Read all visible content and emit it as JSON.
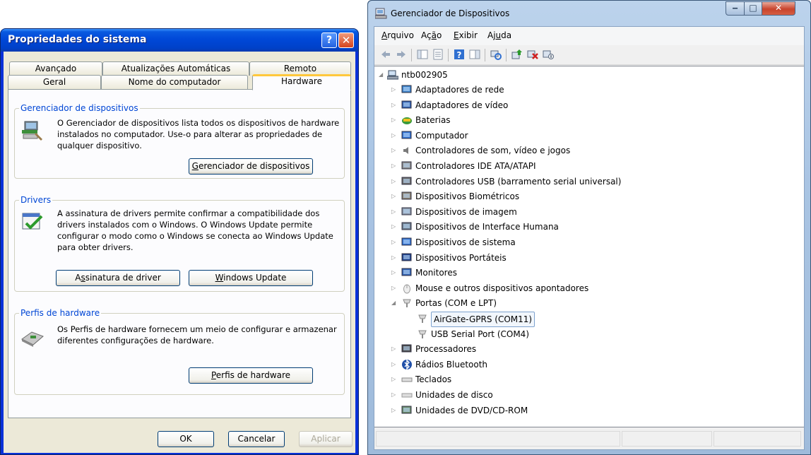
{
  "xp": {
    "title": "Propriedades do sistema",
    "help_glyph": "?",
    "close_glyph": "✕",
    "tabs_top": [
      "Avançado",
      "Atualizações Automáticas",
      "Remoto"
    ],
    "tabs_bottom": [
      "Geral",
      "Nome do computador",
      "Hardware"
    ],
    "groups": {
      "device_manager": {
        "label": "Gerenciador de dispositivos",
        "text": "O Gerenciador de dispositivos lista todos os dispositivos de hardware instalados no computador. Use-o para alterar as propriedades de qualquer dispositivo.",
        "button_first": "G",
        "button_rest": "erenciador de dispositivos"
      },
      "drivers": {
        "label": "Drivers",
        "text": "A assinatura de drivers permite confirmar a compatibilidade dos drivers instalados com o Windows. O Windows Update permite configurar o modo como o Windows se conecta ao Windows Update para obter drivers.",
        "btn_sign_pre": "A",
        "btn_sign_u": "s",
        "btn_sign_post": "sinatura de driver",
        "btn_update_u": "W",
        "btn_update_rest": "indows Update"
      },
      "profiles": {
        "label": "Perfis de hardware",
        "text": "Os Perfis de hardware fornecem um meio de configurar e armazenar diferentes configurações de hardware.",
        "button_u": "P",
        "button_rest": "erfis de hardware"
      }
    },
    "footer": {
      "ok": "OK",
      "cancel": "Cancelar",
      "apply": "Aplicar"
    }
  },
  "devmgr": {
    "title": "Gerenciador de Dispositivos",
    "min_glyph": "‒",
    "max_glyph": "□",
    "close_glyph": "✕",
    "menu": [
      {
        "u": "A",
        "rest": "rquivo"
      },
      {
        "pre": "Aç",
        "u": "ã",
        "rest": "o"
      },
      {
        "u": "E",
        "rest": "xibir"
      },
      {
        "pre": "Aj",
        "u": "u",
        "rest": "da"
      }
    ],
    "root": "ntb002905",
    "devices": [
      {
        "label": "Adaptadores de rede",
        "icon": "network-adapter-icon"
      },
      {
        "label": "Adaptadores de vídeo",
        "icon": "display-adapter-icon"
      },
      {
        "label": "Baterias",
        "icon": "battery-icon"
      },
      {
        "label": "Computador",
        "icon": "computer-icon"
      },
      {
        "label": "Controladores de som, vídeo e jogos",
        "icon": "speaker-icon"
      },
      {
        "label": "Controladores IDE ATA/ATAPI",
        "icon": "ide-controller-icon"
      },
      {
        "label": "Controladores USB (barramento serial universal)",
        "icon": "usb-icon"
      },
      {
        "label": "Dispositivos Biométricos",
        "icon": "fingerprint-icon"
      },
      {
        "label": "Dispositivos de imagem",
        "icon": "scanner-icon"
      },
      {
        "label": "Dispositivos de Interface Humana",
        "icon": "hid-icon"
      },
      {
        "label": "Dispositivos de sistema",
        "icon": "system-device-icon"
      },
      {
        "label": "Dispositivos Portáteis",
        "icon": "portable-device-icon"
      },
      {
        "label": "Monitores",
        "icon": "monitor-icon"
      },
      {
        "label": "Mouse e outros dispositivos apontadores",
        "icon": "mouse-icon"
      },
      {
        "label": "Portas (COM e LPT)",
        "icon": "port-icon"
      }
    ],
    "ports_children": [
      {
        "label": "AirGate-GPRS (COM11)",
        "selected": true
      },
      {
        "label": "USB Serial Port (COM4)",
        "selected": false
      }
    ],
    "devices_after": [
      {
        "label": "Processadores",
        "icon": "processor-icon"
      },
      {
        "label": "Rádios Bluetooth",
        "icon": "bluetooth-icon"
      },
      {
        "label": "Teclados",
        "icon": "keyboard-icon"
      },
      {
        "label": "Unidades de disco",
        "icon": "disk-drive-icon"
      },
      {
        "label": "Unidades de DVD/CD-ROM",
        "icon": "dvd-drive-icon"
      }
    ],
    "colors": {
      "selection_border": "#7da2ce",
      "xp_title": "#0048d8",
      "xp_group_label": "#0046d5"
    }
  }
}
